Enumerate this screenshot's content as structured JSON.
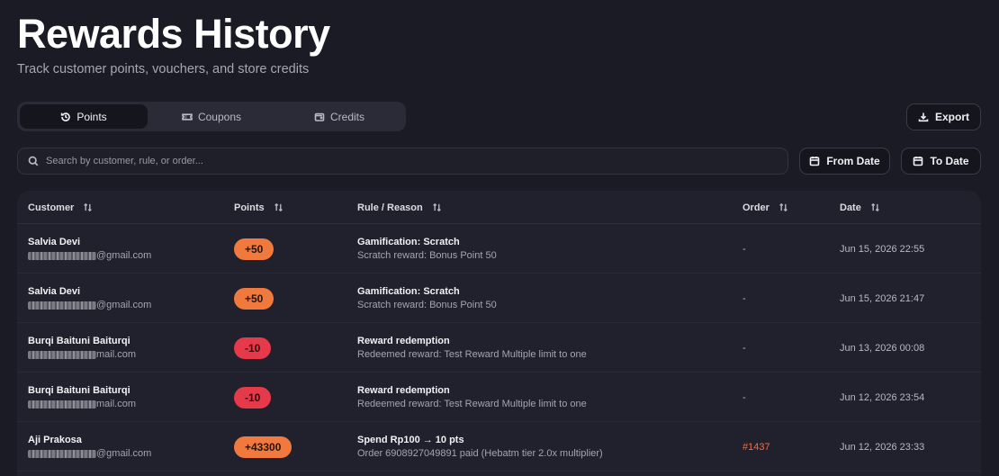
{
  "header": {
    "title": "Rewards History",
    "subtitle": "Track customer points, vouchers, and store credits"
  },
  "tabs": [
    {
      "label": "Points",
      "icon": "history-icon",
      "active": true
    },
    {
      "label": "Coupons",
      "icon": "ticket-icon",
      "active": false
    },
    {
      "label": "Credits",
      "icon": "wallet-icon",
      "active": false
    }
  ],
  "toolbar": {
    "export_label": "Export",
    "from_date_label": "From Date",
    "to_date_label": "To Date"
  },
  "search": {
    "placeholder": "Search by customer, rule, or order...",
    "value": ""
  },
  "table": {
    "columns": [
      "Customer",
      "Points",
      "Rule / Reason",
      "Order",
      "Date"
    ],
    "rows": [
      {
        "name": "Salvia Devi",
        "email_visible": "@gmail.com",
        "points": "+50",
        "points_type": "positive",
        "rule_title": "Gamification: Scratch",
        "rule_detail": "Scratch reward: Bonus Point 50",
        "order": "-",
        "date": "Jun 15, 2026 22:55"
      },
      {
        "name": "Salvia Devi",
        "email_visible": "@gmail.com",
        "points": "+50",
        "points_type": "positive",
        "rule_title": "Gamification: Scratch",
        "rule_detail": "Scratch reward: Bonus Point 50",
        "order": "-",
        "date": "Jun 15, 2026 21:47"
      },
      {
        "name": "Burqi Baituni Baiturqi",
        "email_visible": "mail.com",
        "points": "-10",
        "points_type": "negative",
        "rule_title": "Reward redemption",
        "rule_detail": "Redeemed reward: Test Reward Multiple limit to one",
        "order": "-",
        "date": "Jun 13, 2026 00:08"
      },
      {
        "name": "Burqi Baituni Baiturqi",
        "email_visible": "mail.com",
        "points": "-10",
        "points_type": "negative",
        "rule_title": "Reward redemption",
        "rule_detail": "Redeemed reward: Test Reward Multiple limit to one",
        "order": "-",
        "date": "Jun 12, 2026 23:54"
      },
      {
        "name": "Aji Prakosa",
        "email_visible": "@gmail.com",
        "points": "+43300",
        "points_type": "positive",
        "rule_title": "Spend Rp100 → 10 pts",
        "rule_detail": "Order 6908927049891 paid (Hebatm tier 2.0x multiplier)",
        "order": "#1437",
        "date": "Jun 12, 2026 23:33"
      }
    ]
  },
  "colors": {
    "background": "#1b1b26",
    "positive_pill": "#f07a3e",
    "negative_pill": "#e6394a",
    "order_link": "#f26b45"
  }
}
